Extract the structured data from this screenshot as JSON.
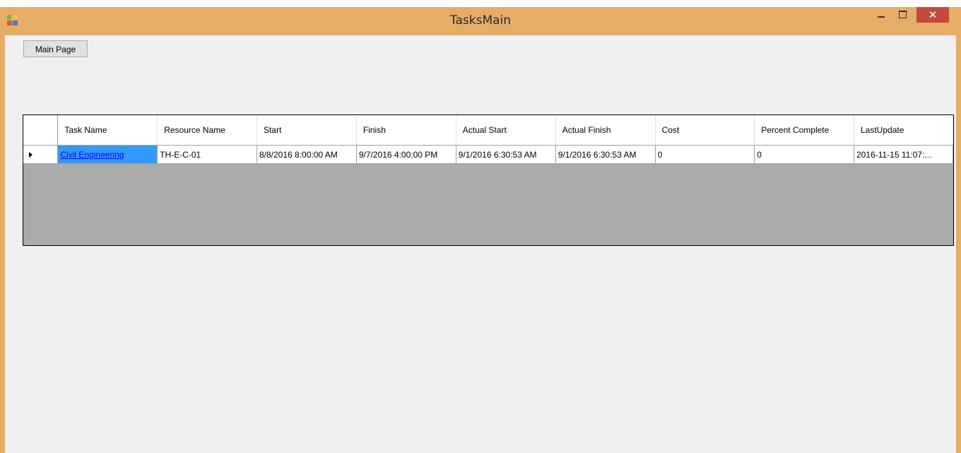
{
  "window": {
    "title": "TasksMain",
    "close_glyph": "✕",
    "accent_color": "#e6ad66",
    "close_color": "#c7483f",
    "icons": [
      "app-icon",
      "minimize-icon",
      "maximize-icon",
      "close-icon"
    ]
  },
  "toolbar": {
    "main_page_label": "Main Page"
  },
  "grid": {
    "columns": [
      "Task Name",
      "Resource Name",
      "Start",
      "Finish",
      "Actual Start",
      "Actual Finish",
      "Cost",
      "Percent Complete",
      "LastUpdate"
    ],
    "rows": [
      {
        "task_name": "Civil Engineering",
        "resource_name": "TH-E-C-01",
        "start": "8/8/2016 8:00:00 AM",
        "finish": "9/7/2016 4:00:00 PM",
        "actual_start": "9/1/2016 6:30:53 AM",
        "actual_finish": "9/1/2016 6:30:53 AM",
        "cost": "0",
        "percent_complete": "0",
        "last_update": "2016-11-15 11:07:..."
      }
    ],
    "selection_color": "#3399ff"
  }
}
